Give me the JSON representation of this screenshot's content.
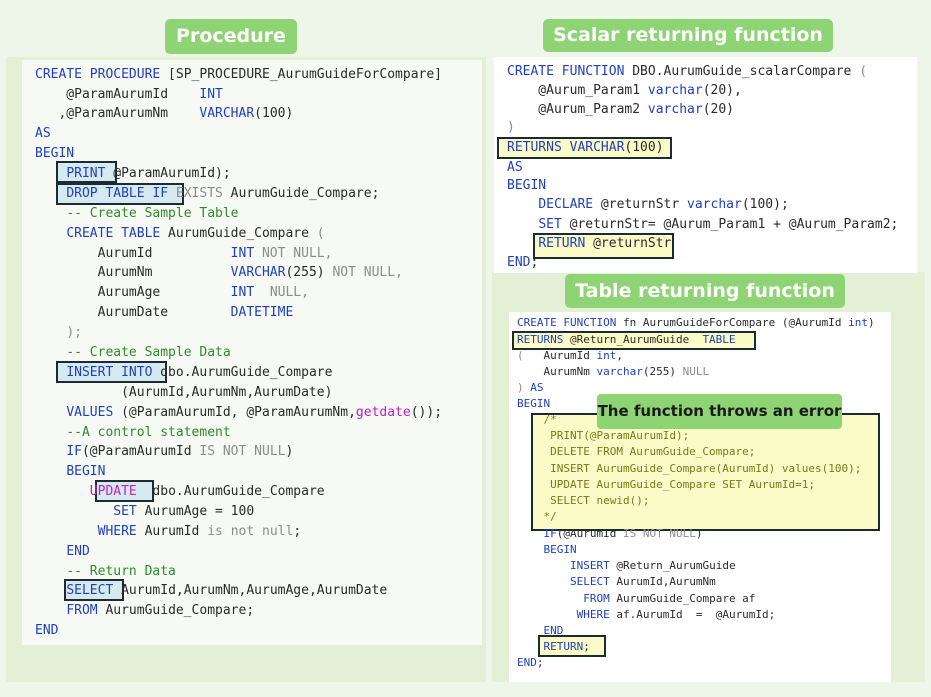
{
  "titles": {
    "procedure": "Procedure",
    "scalar": "Scalar returning function",
    "table": "Table returning function",
    "error_note": "The function throws an error"
  },
  "procedure_code": [
    "CREATE PROCEDURE [SP_PROCEDURE_AurumGuideForCompare]",
    "    @ParamAurumId     INT",
    "   ,@ParamAurumNm     VARCHAR(100)",
    "AS",
    "BEGIN",
    "    PRINT @ParamAurumId);",
    "    DROP TABLE IF EXISTS AurumGuide_Compare;",
    "    -- Create Sample Table",
    "    CREATE TABLE AurumGuide_Compare (",
    "        AurumId           INT NOT NULL,",
    "        AurumNm           VARCHAR(255) NOT NULL,",
    "        AurumAge          INT  NULL,",
    "        AurumDate         DATETIME",
    "    );",
    "    -- Create Sample Data",
    "    INSERT INTO dbo.AurumGuide_Compare",
    "            (AurumId,AurumNm,AurumDate)",
    "    VALUES (@ParamAurumId, @ParamAurumNm,getdate());",
    "    --A control statement",
    "    IF(@ParamAurumId IS NOT NULL)",
    "    BEGIN",
    "        UPDATE  dbo.AurumGuide_Compare",
    "           SET AurumAge = 100",
    "         WHERE AurumId is not null;",
    "    END",
    "    -- Return Data",
    "    SELECT AurumId,AurumNm,AurumAge,AurumDate",
    "    FROM AurumGuide_Compare;",
    "END"
  ],
  "scalar_code": [
    "CREATE FUNCTION DBO.AurumGuide_scalarCompare (",
    "    @Aurum_Param1 varchar(20),",
    "    @Aurum_Param2 varchar(20)",
    ")",
    "RETURNS VARCHAR(100)",
    "AS",
    "BEGIN",
    "    DECLARE @returnStr varchar(100);",
    "    SET @returnStr= @Aurum_Param1 + @Aurum_Param2;",
    "    RETURN @returnStr",
    "END;"
  ],
  "table_code": [
    "CREATE FUNCTION fn AurumGuideForCompare (@AurumId int)",
    "RETURNS @Return_AurumGuide  TABLE",
    "(   AurumId int,",
    "    AurumNm varchar(255) NULL",
    ") AS",
    "BEGIN",
    "    /*",
    "     PRINT(@ParamAurumId);",
    "     DELETE FROM AurumGuide_Compare;",
    "     INSERT AurumGuide_Compare(AurumId) values(100);",
    "     UPDATE AurumGuide_Compare SET AurumId=1;",
    "     SELECT newid();",
    "    */",
    "    IF(@AurumId IS NOT NULL)",
    "    BEGIN",
    "        INSERT @Return_AurumGuide",
    "        SELECT AurumId,AurumNm",
    "          FROM AurumGuide_Compare af",
    "         WHERE af.AurumId  =  @AurumId;",
    "    END",
    "    RETURN;",
    "END;"
  ],
  "colors": {
    "keyword": "#1f3fbf",
    "comment": "#2e8b2e",
    "function": "#c020c0",
    "pill": "#8fd474",
    "highlight_box": "#1b2b33",
    "comment_block_bg": "#fbfbc7"
  }
}
